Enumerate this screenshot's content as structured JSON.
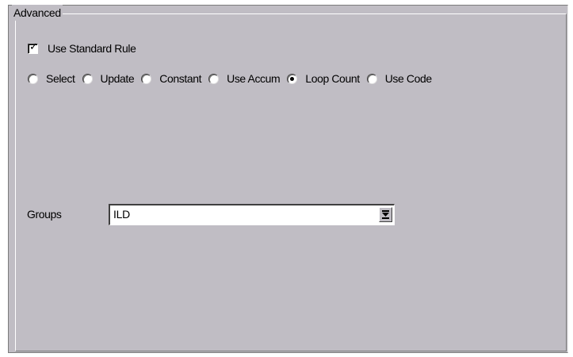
{
  "group": {
    "legend": "Advanced"
  },
  "use_standard_rule": {
    "label": "Use Standard Rule",
    "checked": true
  },
  "radio_options": [
    {
      "label": "Select",
      "selected": false
    },
    {
      "label": "Update",
      "selected": false
    },
    {
      "label": "Constant",
      "selected": false
    },
    {
      "label": "Use Accum",
      "selected": false
    },
    {
      "label": "Loop Count",
      "selected": true
    },
    {
      "label": "Use Code",
      "selected": false
    }
  ],
  "groups_field": {
    "label": "Groups",
    "value": "ILD",
    "dropdown_icon": "arrow-down-bar-icon"
  },
  "colors": {
    "panel_background": "#c0bdc4",
    "field_background": "#ffffff"
  }
}
